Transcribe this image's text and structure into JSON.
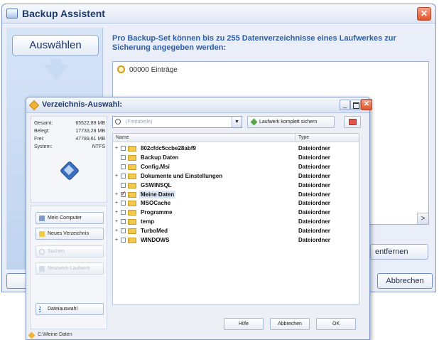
{
  "main_window": {
    "title": "Backup Assistent",
    "close_symbol": "✕",
    "select_button": "Auswählen",
    "intro_text": "Pro Backup-Set können bis zu 255 Datenverzeichnisse eines Laufwerkes zur Sicherung angegeben werden:",
    "list_entry": "00000 Einträge",
    "scroll_right_symbol": ">",
    "remove_button": "entfernen",
    "cancel_button": "Abbrechen"
  },
  "dialog": {
    "title": "Verzeichnis-Auswahl:",
    "minimize_symbol": "_",
    "close_symbol": "✕",
    "drive_info": [
      {
        "label": "Gesamt:",
        "value": "65522,89 MB"
      },
      {
        "label": "Belegt:",
        "value": "17733,28 MB"
      },
      {
        "label": "Frei:",
        "value": "47789,61 MB"
      },
      {
        "label": "System:",
        "value": "NTFS"
      }
    ],
    "side_buttons": {
      "my_computer": "Mein Computer",
      "new_folder": "Neues Verzeichnis",
      "search": "Suchen",
      "network": "Netzwerk-Laufwerk",
      "file_selection": "Dateiauswahl"
    },
    "path_placeholder": "(Freitabelle)",
    "dropdown_symbol": "▼",
    "full_drive_button": "Laufwerk komplett sichern",
    "tree": {
      "col_name": "Name",
      "col_type": "Type",
      "rows": [
        {
          "name": "802cfdc5ccbe28abf9",
          "type": "Dateiordner",
          "expander": "+",
          "checked": false
        },
        {
          "name": "Backup Daten",
          "type": "Dateiordner",
          "expander": "",
          "checked": false
        },
        {
          "name": "Config.Msi",
          "type": "Dateiordner",
          "expander": "",
          "checked": false
        },
        {
          "name": "Dokumente und Einstellungen",
          "type": "Dateiordner",
          "expander": "+",
          "checked": false
        },
        {
          "name": "GSWINSQL",
          "type": "Dateiordner",
          "expander": "",
          "checked": false
        },
        {
          "name": "Meine Daten",
          "type": "Dateiordner",
          "expander": "+",
          "checked": true
        },
        {
          "name": "MSOCache",
          "type": "Dateiordner",
          "expander": "+",
          "checked": false
        },
        {
          "name": "Programme",
          "type": "Dateiordner",
          "expander": "+",
          "checked": false
        },
        {
          "name": "temp",
          "type": "Dateiordner",
          "expander": "+",
          "checked": false
        },
        {
          "name": "TurboMed",
          "type": "Dateiordner",
          "expander": "+",
          "checked": false
        },
        {
          "name": "WINDOWS",
          "type": "Dateiordner",
          "expander": "+",
          "checked": false
        }
      ]
    },
    "help_button": "Hilfe",
    "cancel_button": "Abbrechen",
    "ok_button": "OK",
    "status_path": "C:\\Meine Daten"
  }
}
